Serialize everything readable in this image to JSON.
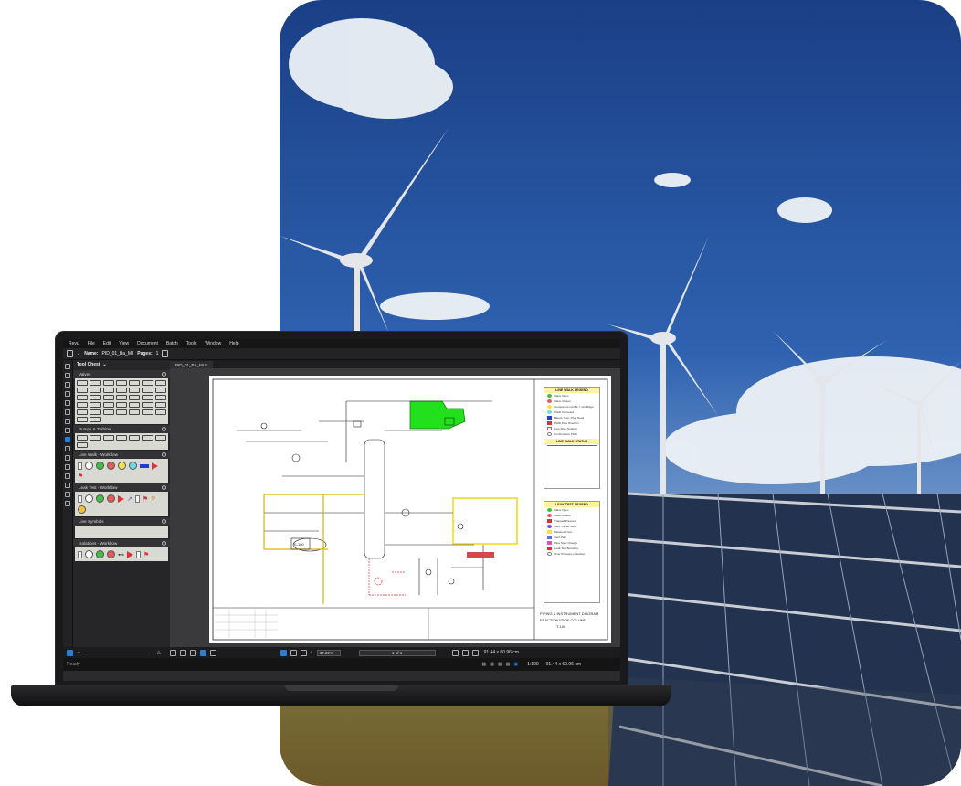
{
  "menu": [
    "Revu",
    "File",
    "Edit",
    "View",
    "Document",
    "Batch",
    "Tools",
    "Window",
    "Help"
  ],
  "doc_toolbar": {
    "name_label": "Name:",
    "name_value": "PID_01_Ba_Mil",
    "pages_label": "Pages:",
    "pages_value": "1"
  },
  "tool_chest": {
    "title": "Tool Chest",
    "sections": [
      "Valves",
      "Pumps & Turbine",
      "Line Walk - Workflow",
      "Leak Test - Workflow",
      "Line Symbols",
      "Isolations - Workflow"
    ]
  },
  "doc_tab": "PID_01_BA_MLF",
  "drawing": {
    "legend1_title": "LINE WALK LEGEND",
    "legend1_items": [
      "Valve Open",
      "Valve Closed",
      "Component not Blk = non-Bulge",
      "P&ID Corrected",
      "Bleed / Cap / Plug Need",
      "P&ID Flow Direction",
      "Line Walk Notation",
      "Confirmation P&ID"
    ],
    "status_title": "LINE WALK STATUS",
    "legend2_title": "LEAK TEST LEGEND",
    "legend2_items": [
      "Valve Open",
      "Valve Closed",
      "Trapped Pressure",
      "Vent / Bleed Valve",
      "Measured Isol.",
      "Vent Path",
      "Pipe Spec Change",
      "Leak Test Boundary",
      "Over Pressure protection"
    ],
    "title_block": [
      "PIPING & INSTRUMENT DIAGRAM",
      "FRACTIONATION COLUMN",
      "T-100"
    ],
    "equip_label": "E-100"
  },
  "status": {
    "zoom": "37.22%",
    "page": "1 of 1",
    "scale": "1:100",
    "size": "91.44 x 60.96 cm",
    "ready": "Ready"
  },
  "colors": {
    "accent": "#2a7fd4",
    "green": "#22c31c",
    "yellow": "#f0d400",
    "red": "#e03030"
  }
}
